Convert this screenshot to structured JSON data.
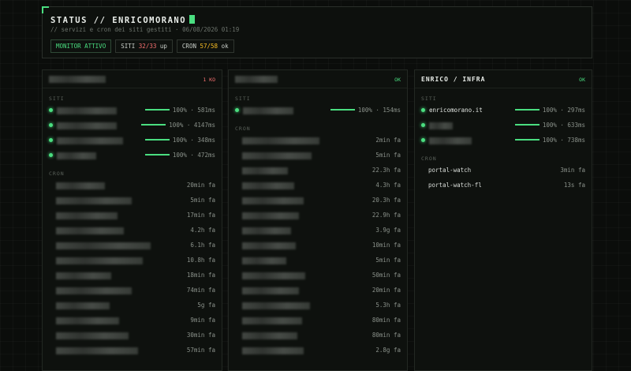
{
  "header": {
    "title": "STATUS // ENRICOMORANO",
    "subtitle": "// servizi e cron dei siti gestiti · 06/08/2026 01:19",
    "monitor": "MONITOR ATTIVO",
    "siti_label": "SITI",
    "siti_value": "32/33",
    "siti_suffix": "up",
    "cron_label": "CRON",
    "cron_value": "57/58",
    "cron_suffix": "ok"
  },
  "labels": {
    "sites": "SITI",
    "cron": "CRON"
  },
  "cards": [
    {
      "title": "",
      "status": "1 KO",
      "status_ko": true,
      "sites": [
        {
          "name": "",
          "stat": "100% · 581ms",
          "blur": 76
        },
        {
          "name": "",
          "stat": "100% · 4147ms",
          "blur": 76
        },
        {
          "name": "",
          "stat": "100% · 348ms",
          "blur": 84
        },
        {
          "name": "",
          "stat": "100% · 472ms",
          "blur": 50
        }
      ],
      "crons": [
        {
          "name": "",
          "time": "20min fa",
          "blur": 62
        },
        {
          "name": "",
          "time": "5min fa",
          "blur": 96
        },
        {
          "name": "",
          "time": "17min fa",
          "blur": 78
        },
        {
          "name": "",
          "time": "4.2h fa",
          "blur": 86
        },
        {
          "name": "",
          "time": "6.1h fa",
          "blur": 120
        },
        {
          "name": "",
          "time": "10.8h fa",
          "blur": 110
        },
        {
          "name": "",
          "time": "18min fa",
          "blur": 70
        },
        {
          "name": "",
          "time": "74min fa",
          "blur": 96
        },
        {
          "name": "",
          "time": "5g fa",
          "blur": 68
        },
        {
          "name": "",
          "time": "9min fa",
          "blur": 80
        },
        {
          "name": "",
          "time": "30min fa",
          "blur": 92
        },
        {
          "name": "",
          "time": "57min fa",
          "blur": 104
        }
      ]
    },
    {
      "title": "",
      "status": "OK",
      "status_ko": false,
      "sites": [
        {
          "name": "",
          "stat": "100% · 154ms",
          "blur": 64
        }
      ],
      "crons": [
        {
          "name": "",
          "time": "2min fa",
          "blur": 98
        },
        {
          "name": "",
          "time": "5min fa",
          "blur": 88
        },
        {
          "name": "",
          "time": "22.3h fa",
          "blur": 58
        },
        {
          "name": "",
          "time": "4.3h fa",
          "blur": 66
        },
        {
          "name": "",
          "time": "20.3h fa",
          "blur": 78
        },
        {
          "name": "",
          "time": "22.9h fa",
          "blur": 72
        },
        {
          "name": "",
          "time": "3.9g fa",
          "blur": 62
        },
        {
          "name": "",
          "time": "10min fa",
          "blur": 68
        },
        {
          "name": "",
          "time": "5min fa",
          "blur": 56
        },
        {
          "name": "",
          "time": "50min fa",
          "blur": 80
        },
        {
          "name": "",
          "time": "20min fa",
          "blur": 72
        },
        {
          "name": "",
          "time": "5.3h fa",
          "blur": 86
        },
        {
          "name": "",
          "time": "80min fa",
          "blur": 76
        },
        {
          "name": "",
          "time": "80min fa",
          "blur": 70
        },
        {
          "name": "",
          "time": "2.8g fa",
          "blur": 78
        }
      ]
    },
    {
      "title": "ENRICO / INFRA",
      "status": "OK",
      "status_ko": false,
      "sites": [
        {
          "name": "enricomorano.it",
          "stat": "100% · 297ms",
          "blur": 0
        },
        {
          "name": "",
          "stat": "100% · 633ms",
          "blur": 30
        },
        {
          "name": "",
          "stat": "100% · 738ms",
          "blur": 54
        }
      ],
      "crons": [
        {
          "name": "portal-watch",
          "time": "3min fa",
          "blur": 0
        },
        {
          "name": "portal-watch-fl",
          "time": "13s fa",
          "blur": 0
        }
      ]
    }
  ],
  "colors": {
    "accent": "#4ade80",
    "error": "#f87171",
    "warn": "#fbbf24"
  }
}
